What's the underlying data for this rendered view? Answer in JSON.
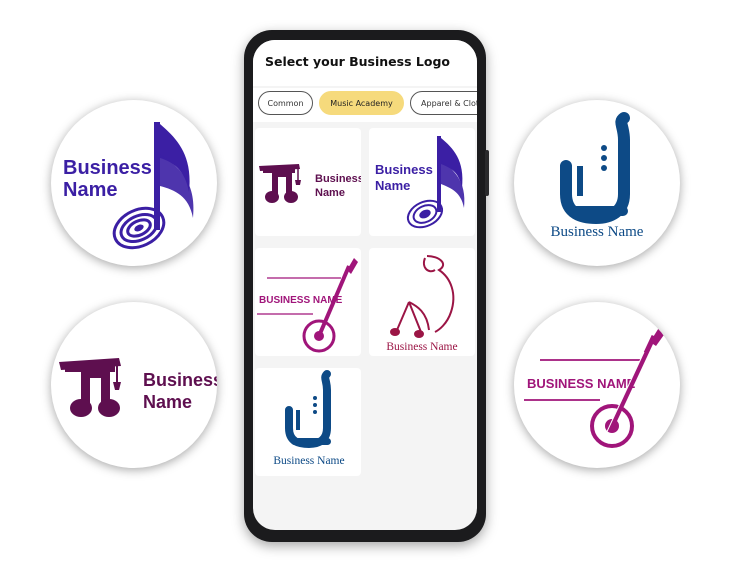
{
  "screen": {
    "title": "Select your Business Logo",
    "tabs": [
      {
        "label": "Common",
        "active": false
      },
      {
        "label": "Music Academy",
        "active": true
      },
      {
        "label": "Apparel & Clot",
        "active": false
      }
    ]
  },
  "logos": {
    "text_stacked_first": "Business",
    "text_stacked_second": "Name",
    "text_inline": "BUSINESS NAME",
    "text_script": "Business Name"
  },
  "colors": {
    "indigo": "#3b1fa4",
    "plum": "#5e0f4f",
    "magenta": "#a0157a",
    "navy": "#0d4a86",
    "crimson": "#9b1545",
    "tab_active": "#f6da7c"
  },
  "icons": [
    "music-note-icon",
    "graduation-cap-note-icon",
    "guitar-icon",
    "saxophone-icon",
    "music-note-figure-icon"
  ]
}
